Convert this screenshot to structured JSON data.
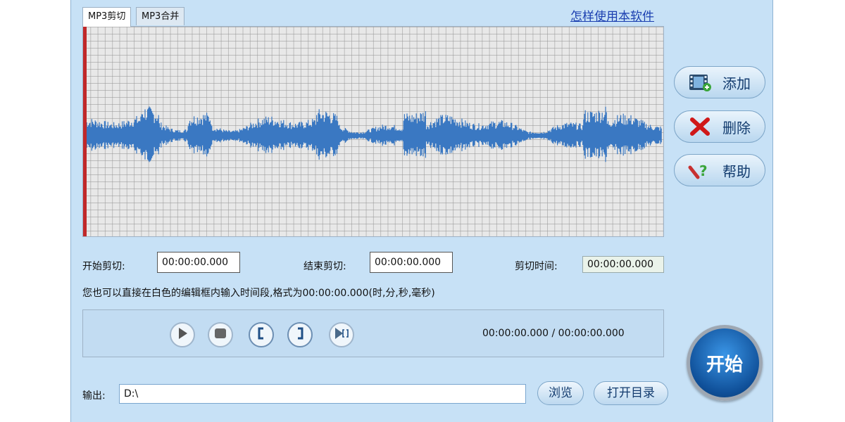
{
  "tabs": [
    {
      "label": "MP3剪切"
    },
    {
      "label": "MP3合并"
    }
  ],
  "help_link": "怎样使用本软件",
  "side_buttons": {
    "add": "添加",
    "delete": "删除",
    "help": "帮助"
  },
  "cut": {
    "start_label": "开始剪切:",
    "start_value": "00:00:00.000",
    "end_label": "结束剪切:",
    "end_value": "00:00:00.000",
    "duration_label": "剪切时间:",
    "duration_value": "00:00:00.000",
    "hint": "您也可以直接在白色的编辑框内输入时间段,格式为00:00:00.000(时,分,秒,毫秒)"
  },
  "player": {
    "time": "00:00:00.000 / 00:00:00.000"
  },
  "start_button": "开始",
  "output": {
    "label": "输出:",
    "path": "D:\\",
    "browse": "浏览",
    "open_dir": "打开目录"
  },
  "colors": {
    "waveform": "#3a78c2",
    "start_marker": "#c0282a",
    "window_bg": "#c7e1f6"
  }
}
